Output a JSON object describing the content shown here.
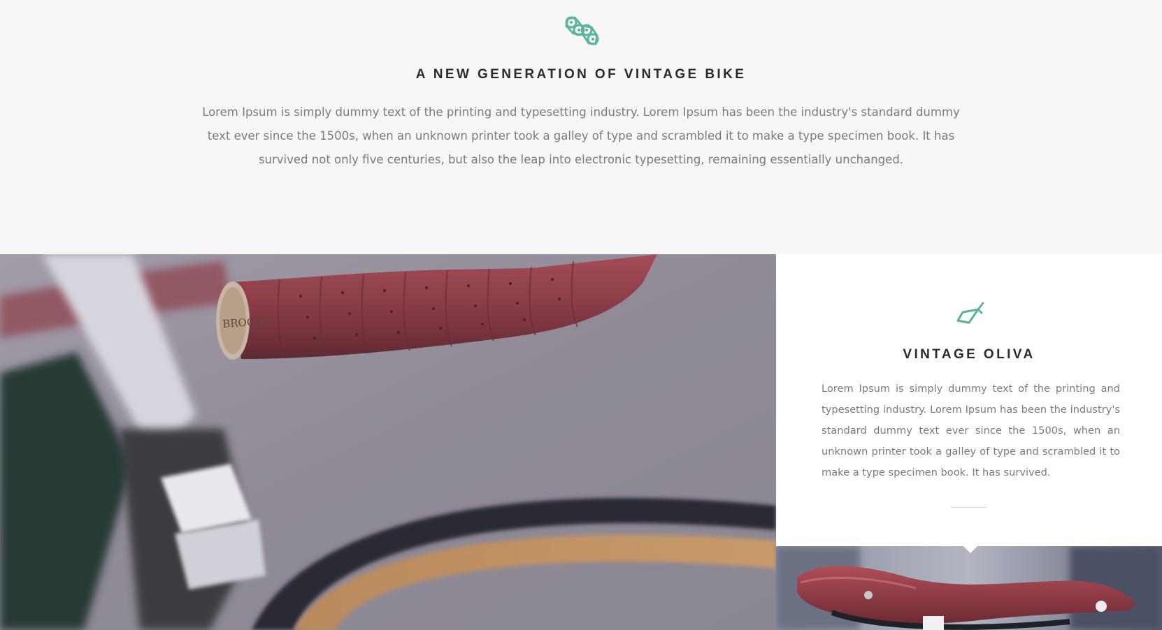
{
  "intro": {
    "icon": "bike-chain-icon",
    "title": "A NEW GENERATION OF VINTAGE BIKE",
    "text": "Lorem Ipsum is simply dummy text of the printing and typesetting industry. Lorem Ipsum has been the industry's standard dummy text ever since the 1500s, when an unknown printer took a galley of type and scrambled it to make a type specimen book. It has survived not only five centuries, but also the leap into electronic typesetting, remaining essentially unchanged."
  },
  "photos": {
    "left": "handlebar-photo",
    "left_brand_stamp": "BROOKS",
    "right": "saddle-photo"
  },
  "card": {
    "icon": "bike-frame-icon",
    "title": "VINTAGE OLIVA",
    "text": "Lorem Ipsum is simply dummy text of the printing and typesetting industry. Lorem Ipsum has been the industry's standard dummy text ever since the 1500s, when an unknown printer took a galley of type and scrambled it to make a type specimen book. It has survived."
  },
  "colors": {
    "accent": "#5bb59a",
    "background": "#f6f6f6",
    "card": "#ffffff",
    "heading": "#2b2b2b",
    "body_text": "#7b7b7b"
  }
}
